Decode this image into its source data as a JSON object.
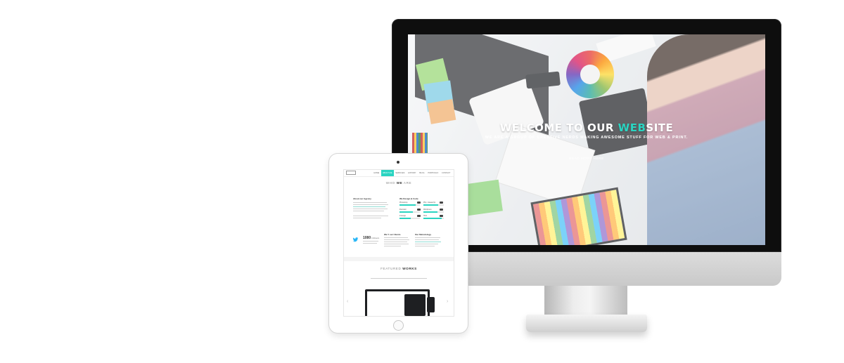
{
  "desktop": {
    "hero": {
      "title_main": "WELCOME TO OUR ",
      "title_accent": "WEB",
      "title_end": "SITE",
      "subtitle": "WE ARE A GROUP OF CREATIVE NERDS MAKING AWESOME STUFF FOR WEB & PRINT.",
      "button": "READ MORE HERE"
    },
    "accent_color": "#2ad4c1"
  },
  "tablet": {
    "nav": {
      "items": [
        "HOME",
        "ABOUT ME",
        "SERVICES",
        "HISTORY",
        "BLOG",
        "PORTFOLIO",
        "CONTACT"
      ],
      "active_index": 1
    },
    "who": {
      "title_light_1": "WHO ",
      "title_bold": "WE",
      "title_light_2": " ARE"
    },
    "about": {
      "heading": "About our Agency"
    },
    "skills": {
      "heading": "We Design & Code",
      "items": [
        {
          "label": "Photoshop",
          "value": 0.8
        },
        {
          "label": "Php / Javascript",
          "value": 0.72
        },
        {
          "label": "Illustrator",
          "value": 0.65
        },
        {
          "label": "Wordpress",
          "value": 0.7
        },
        {
          "label": "Indesign",
          "value": 0.55
        },
        {
          "label": "Html",
          "value": 0.9
        }
      ]
    },
    "twitter": {
      "count": "1080",
      "followers": "Followers"
    },
    "clients": {
      "heading": "We ♥ our Clients"
    },
    "metodology": {
      "heading": "Our Metodology"
    },
    "featured": {
      "title_light": "FEATURED ",
      "title_bold": "WORKS"
    }
  }
}
